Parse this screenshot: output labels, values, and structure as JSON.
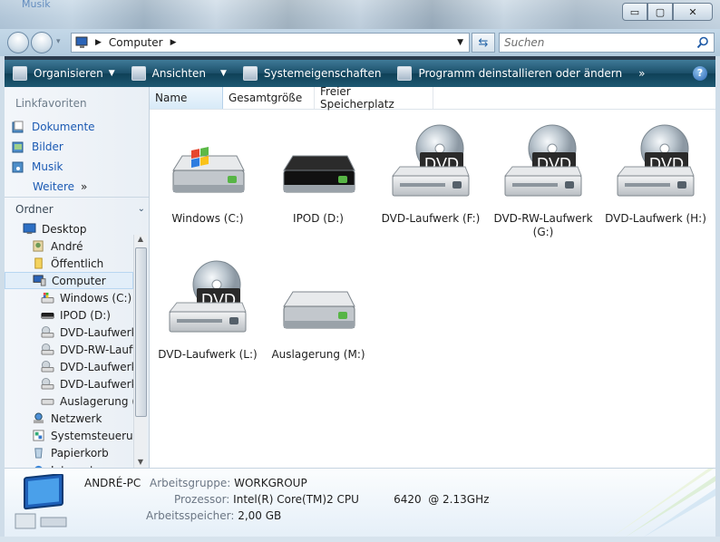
{
  "window": {
    "ghost_title": "Musik",
    "minimize": "▭",
    "maximize": "▢",
    "close": "✕"
  },
  "address": {
    "path": "Computer",
    "search_placeholder": "Suchen"
  },
  "toolbar": {
    "organize": "Organisieren",
    "views": "Ansichten",
    "properties": "Systemeigenschaften",
    "uninstall": "Programm deinstallieren oder ändern",
    "more": "»",
    "help": "?"
  },
  "sidebar": {
    "favorites_header": "Linkfavoriten",
    "favorites": [
      "Dokumente",
      "Bilder",
      "Musik"
    ],
    "more": "Weitere",
    "more_arrow": "»",
    "folders_header": "Ordner",
    "tree": [
      {
        "label": "Desktop",
        "indent": 0,
        "icon": "desktop"
      },
      {
        "label": "André",
        "indent": 1,
        "icon": "user"
      },
      {
        "label": "Öffentlich",
        "indent": 1,
        "icon": "folder"
      },
      {
        "label": "Computer",
        "indent": 1,
        "icon": "computer",
        "selected": true
      },
      {
        "label": "Windows (C:)",
        "indent": 2,
        "icon": "hdd-win"
      },
      {
        "label": "IPOD (D:)",
        "indent": 2,
        "icon": "hdd-black"
      },
      {
        "label": "DVD-Laufwerk",
        "indent": 2,
        "icon": "dvd"
      },
      {
        "label": "DVD-RW-Laufw",
        "indent": 2,
        "icon": "dvd"
      },
      {
        "label": "DVD-Laufwerk",
        "indent": 2,
        "icon": "dvd"
      },
      {
        "label": "DVD-Laufwerk",
        "indent": 2,
        "icon": "dvd"
      },
      {
        "label": "Auslagerung (M",
        "indent": 2,
        "icon": "hdd"
      },
      {
        "label": "Netzwerk",
        "indent": 1,
        "icon": "network"
      },
      {
        "label": "Systemsteuerung",
        "indent": 1,
        "icon": "control"
      },
      {
        "label": "Papierkorb",
        "indent": 1,
        "icon": "bin"
      },
      {
        "label": "Internet",
        "indent": 1,
        "icon": "ie"
      }
    ]
  },
  "columns": [
    "Name",
    "Gesamtgröße",
    "Freier Speicherplatz"
  ],
  "drives": [
    {
      "label": "Windows (C:)",
      "icon": "hdd-win"
    },
    {
      "label": "IPOD (D:)",
      "icon": "hdd-black"
    },
    {
      "label": "DVD-Laufwerk (F:)",
      "icon": "dvd"
    },
    {
      "label": "DVD-RW-Laufwerk (G:)",
      "icon": "dvd"
    },
    {
      "label": "DVD-Laufwerk (H:)",
      "icon": "dvd"
    },
    {
      "label": "DVD-Laufwerk (L:)",
      "icon": "dvd"
    },
    {
      "label": "Auslagerung (M:)",
      "icon": "hdd"
    }
  ],
  "dvd_badge": "DVD",
  "details": {
    "pc_name": "ANDRÉ-PC",
    "workgroup_label": "Arbeitsgruppe:",
    "workgroup": "WORKGROUP",
    "cpu_label": "Prozessor:",
    "cpu": "Intel(R) Core(TM)2 CPU          6420  @ 2.13GHz",
    "ram_label": "Arbeitsspeicher:",
    "ram": "2,00 GB"
  },
  "colors": {
    "toolbar": "#1b4f69",
    "link": "#1b5ab3",
    "selection": "#e2eef9"
  }
}
